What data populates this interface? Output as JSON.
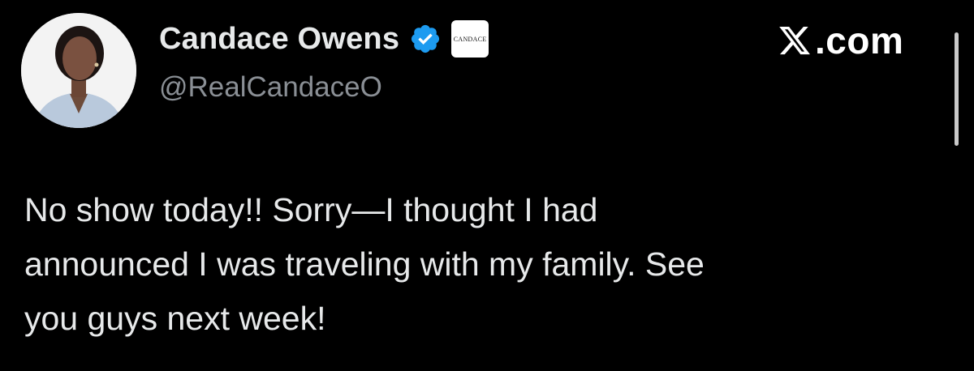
{
  "author": {
    "display_name": "Candace Owens",
    "handle": "@RealCandaceO",
    "verified_icon": "verified-badge-icon",
    "affiliate_badge_text": "CANDACE"
  },
  "brand": {
    "logo_icon": "x-logo-icon",
    "suffix": ".com"
  },
  "tweet": {
    "text": "No show today!! Sorry—I thought I had\nannounced I was traveling with my family. See\nyou guys next week!"
  },
  "colors": {
    "background": "#000000",
    "text_primary": "#e7e9ea",
    "text_secondary": "#8a8f95",
    "verified_blue": "#1d9bf0"
  }
}
